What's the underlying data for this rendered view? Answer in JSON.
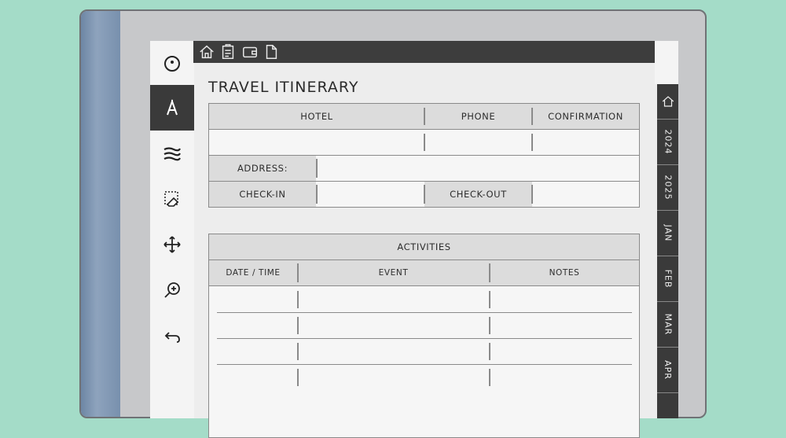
{
  "toolbar": {
    "tools": [
      {
        "icon": "menu-circle-icon"
      },
      {
        "icon": "pen-icon",
        "active": true
      },
      {
        "icon": "stroke-width-icon"
      },
      {
        "icon": "eraser-selection-icon"
      },
      {
        "icon": "move-icon"
      },
      {
        "icon": "zoom-in-icon"
      },
      {
        "icon": "undo-icon"
      }
    ]
  },
  "topbar": {
    "icons": [
      "home-icon",
      "clipboard-icon",
      "wallet-icon",
      "document-icon"
    ]
  },
  "page": {
    "title": "TRAVEL ITINERARY",
    "hotel_section": {
      "hotel": "HOTEL",
      "phone": "PHONE",
      "confirmation": "CONFIRMATION",
      "address": "ADDRESS:",
      "check_in": "CHECK-IN",
      "check_out": "CHECK-OUT"
    },
    "activities_section": {
      "title": "ACTIVITIES",
      "columns": [
        "DATE / TIME",
        "EVENT",
        "NOTES"
      ]
    }
  },
  "side_tabs": [
    {
      "icon": "home-icon",
      "label": ""
    },
    {
      "label": "2024"
    },
    {
      "label": "2025"
    },
    {
      "label": "JAN"
    },
    {
      "label": "FEB"
    },
    {
      "label": "MAR"
    },
    {
      "label": "APR"
    }
  ],
  "colors": {
    "background": "#a4dcc8",
    "device_frame": "#c7c8ca",
    "spine": "#7a91ad",
    "dark_bar": "#3d3d3d",
    "cell_shade": "#dcdcdc"
  }
}
